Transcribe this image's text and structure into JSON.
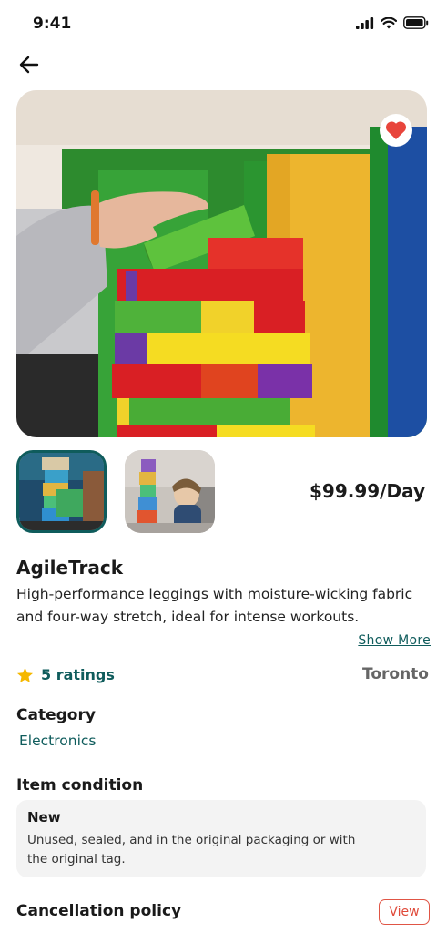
{
  "status_bar": {
    "time": "9:41"
  },
  "product": {
    "price": "$99.99/Day",
    "title": "AgileTrack",
    "description": "High-performance leggings with moisture-wicking fabric and four-way stretch, ideal for intense workouts.",
    "show_more": "Show More",
    "ratings": "5 ratings",
    "location": "Toronto",
    "favorited": true
  },
  "category": {
    "heading": "Category",
    "value": "Electronics"
  },
  "condition": {
    "heading": "Item condition",
    "title": "New",
    "description": "Unused, sealed, and in the original packaging or with the original tag."
  },
  "cancellation": {
    "heading": "Cancellation policy",
    "button": "View"
  },
  "colors": {
    "accent": "#0f5c5c",
    "heart": "#e8453c",
    "star": "#f5b800",
    "view_border": "#e05545"
  },
  "icons": [
    "back-arrow-icon",
    "heart-icon",
    "star-icon",
    "signal-icon",
    "wifi-icon",
    "battery-icon"
  ]
}
